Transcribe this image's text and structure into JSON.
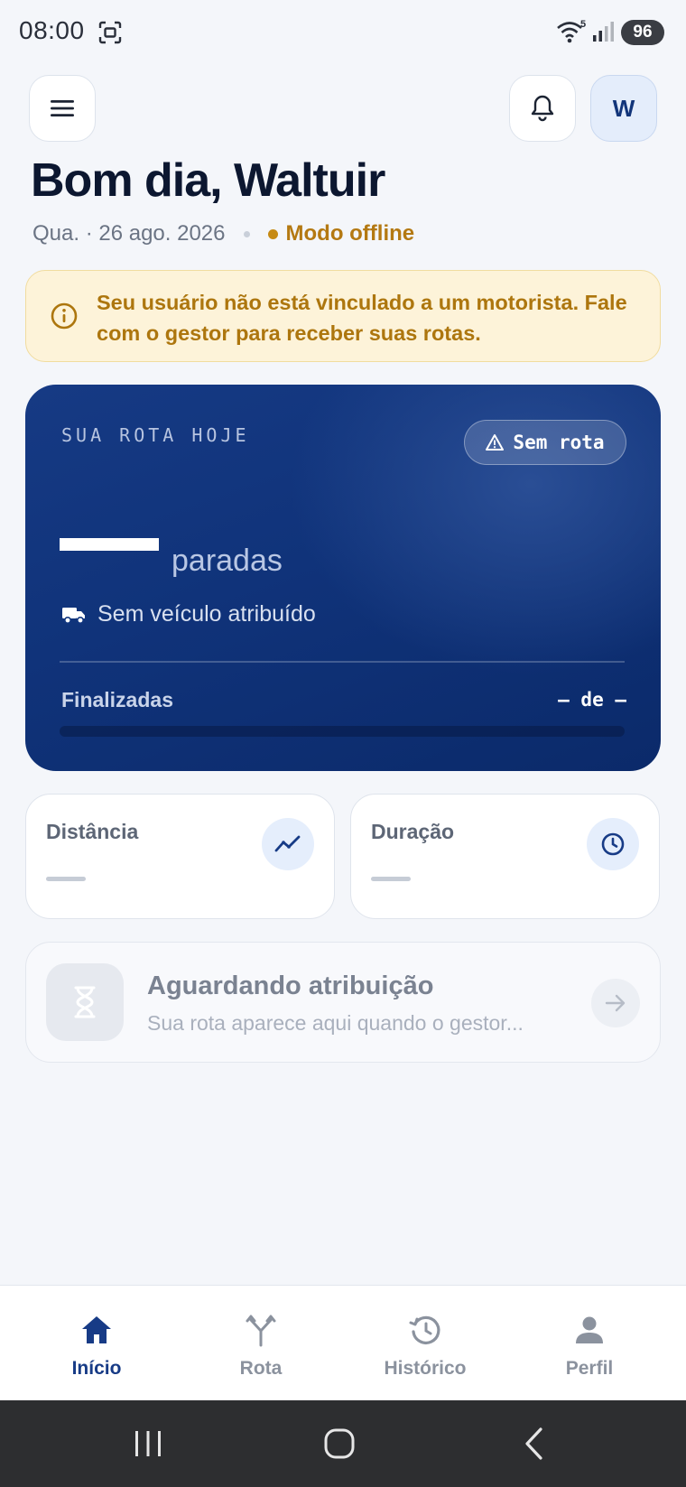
{
  "status_bar": {
    "time": "08:00",
    "wifi_badge": "5",
    "battery": "96",
    "icons": [
      "screenshot-icon",
      "wifi-icon",
      "signal-icon",
      "battery-icon"
    ]
  },
  "header": {
    "menu_icon": "menu-icon",
    "bell_icon": "bell-icon",
    "avatar_initial": "W",
    "greeting": "Bom dia, Waltuir",
    "date": "Qua. · 26 ago. 2026",
    "offline_label": "Modo offline"
  },
  "warning": {
    "icon": "info-icon",
    "text": "Seu usuário não está vinculado a um motorista. Fale com o gestor para receber suas rotas."
  },
  "route_card": {
    "label": "SUA ROTA HOJE",
    "badge": "Sem rota",
    "stops_label": "paradas",
    "vehicle": "Sem veículo atribuído",
    "finalized_label": "Finalizadas",
    "finalized_count": "— de —",
    "progress": 0
  },
  "metrics": {
    "distance_label": "Distância",
    "duration_label": "Duração"
  },
  "awaiting": {
    "title": "Aguardando atribuição",
    "subtitle": "Sua rota aparece aqui quando o gestor..."
  },
  "bottom_nav": {
    "items": [
      {
        "label": "Início",
        "icon": "home-icon",
        "active": true
      },
      {
        "label": "Rota",
        "icon": "route-icon",
        "active": false
      },
      {
        "label": "Histórico",
        "icon": "history-icon",
        "active": false
      },
      {
        "label": "Perfil",
        "icon": "profile-icon",
        "active": false
      }
    ]
  },
  "colors": {
    "primary": "#173b86",
    "background": "#f4f6fa",
    "warning": "#ad760e",
    "offline": "#b47912"
  }
}
